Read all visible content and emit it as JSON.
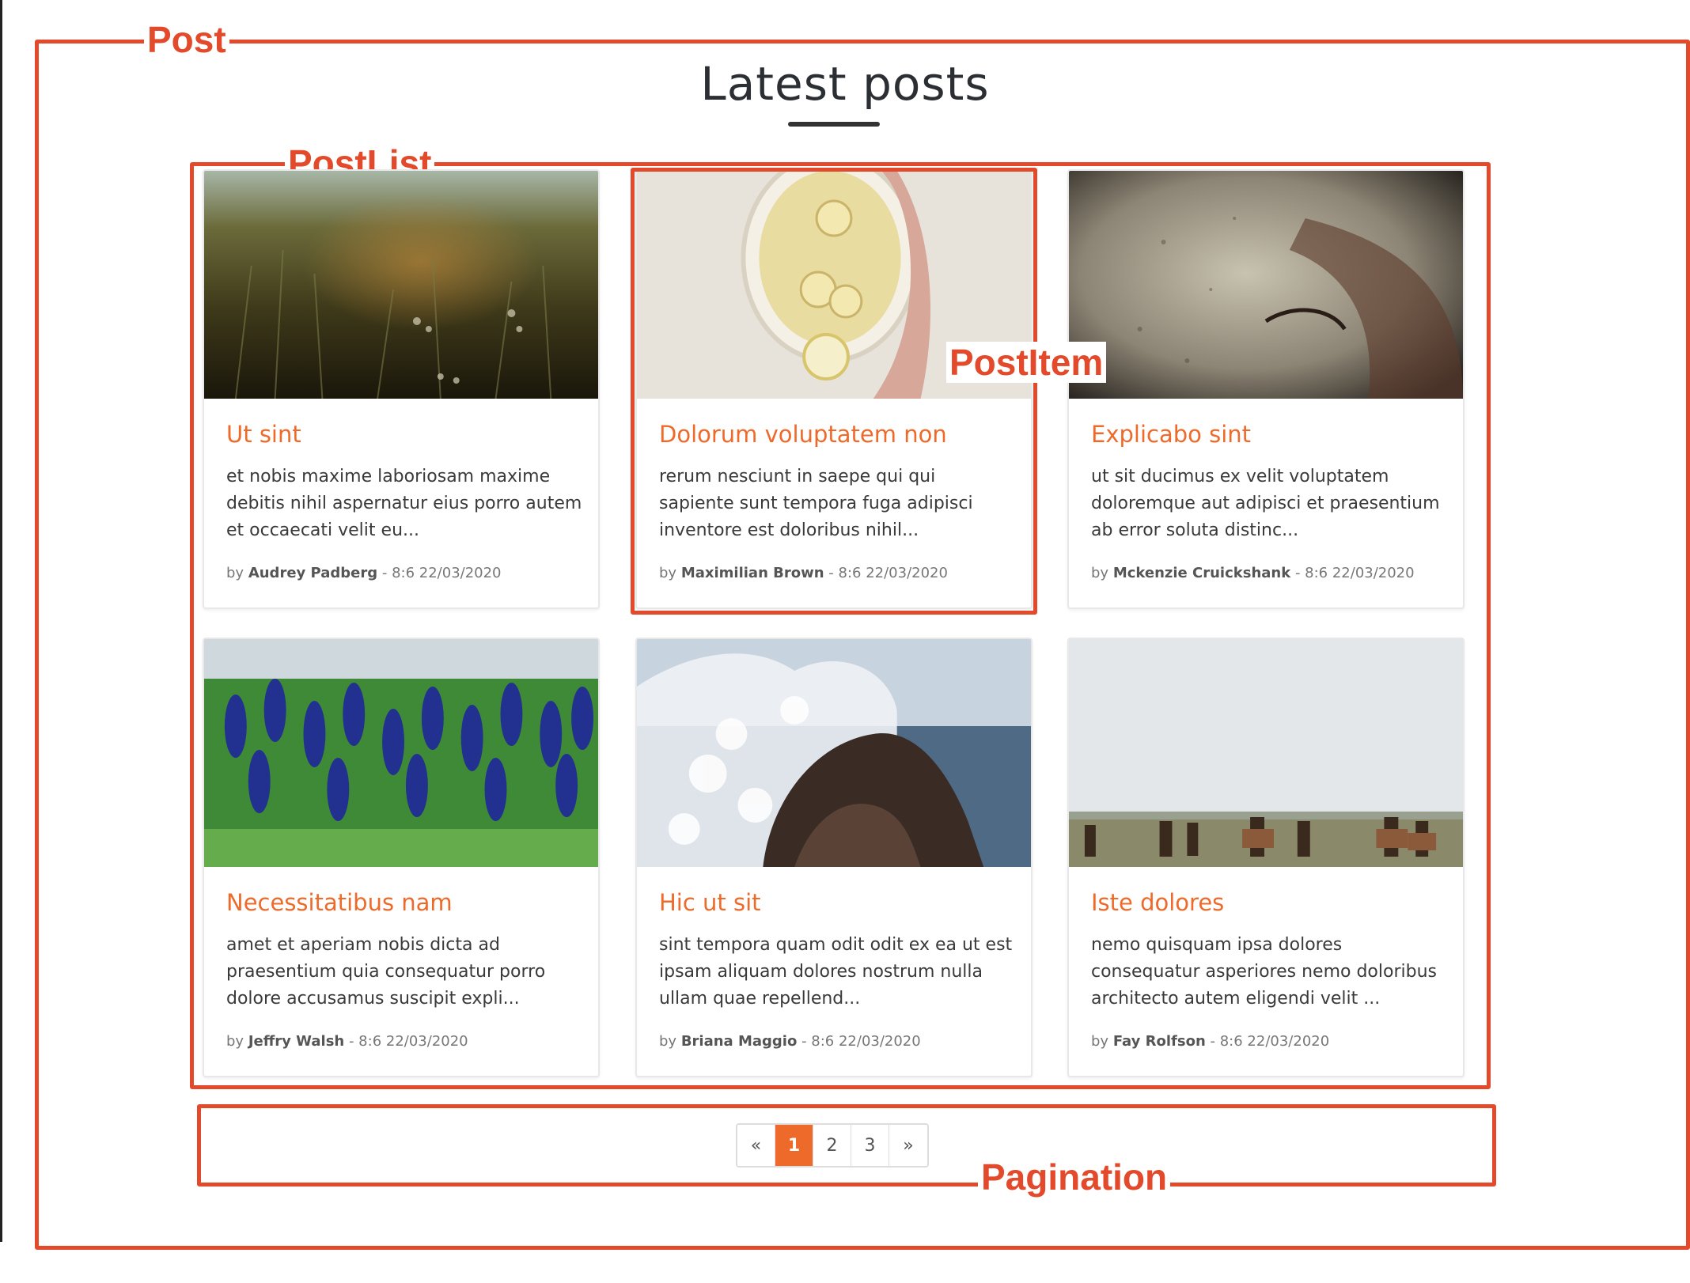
{
  "annotations": {
    "post": "Post",
    "post_list": "PostList",
    "post_item": "PostItem",
    "pagination": "Pagination"
  },
  "page": {
    "title": "Latest posts"
  },
  "posts": [
    {
      "title": "Ut sint",
      "excerpt": "et nobis maxime laboriosam maxime debitis nihil aspernatur eius porro autem et occaecati velit eu...",
      "by": "by",
      "author": "Audrey Padberg",
      "date": "- 8:6 22/03/2020",
      "image": "grass-field"
    },
    {
      "title": "Dolorum voluptatem non",
      "excerpt": "rerum nesciunt in saepe qui qui sapiente sunt tempora fuga adipisci inventore est doloribus nihil...",
      "by": "by",
      "author": "Maximilian Brown",
      "date": "- 8:6 22/03/2020",
      "image": "tea-bowl"
    },
    {
      "title": "Explicabo sint",
      "excerpt": "ut sit ducimus ex velit voluptatem doloremque aut adipisci et praesentium ab error soluta distinc...",
      "by": "by",
      "author": "Mckenzie Cruickshank",
      "date": "- 8:6 22/03/2020",
      "image": "old-car"
    },
    {
      "title": "Necessitatibus nam",
      "excerpt": "amet et aperiam nobis dicta ad praesentium quia consequatur porro dolore accusamus suscipit expli...",
      "by": "by",
      "author": "Jeffry Walsh",
      "date": "- 8:6 22/03/2020",
      "image": "bluebonnets"
    },
    {
      "title": "Hic ut sit",
      "excerpt": "sint tempora quam odit odit ex ea ut est ipsam aliquam dolores nostrum nulla ullam quae repellend...",
      "by": "by",
      "author": "Briana Maggio",
      "date": "- 8:6 22/03/2020",
      "image": "wave-rock"
    },
    {
      "title": "Iste dolores",
      "excerpt": "nemo quisquam ipsa dolores consequatur asperiores nemo doloribus architecto autem eligendi velit ...",
      "by": "by",
      "author": "Fay Rolfson",
      "date": "- 8:6 22/03/2020",
      "image": "horses"
    }
  ],
  "pagination": {
    "prev": "«",
    "pages": [
      "1",
      "2",
      "3"
    ],
    "next": "»",
    "active": "1"
  },
  "colors": {
    "annotation": "#e24a2b",
    "accent": "#ee6a2b"
  }
}
